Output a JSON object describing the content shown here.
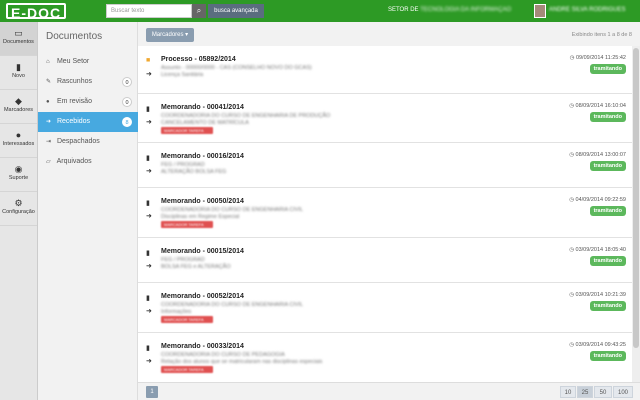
{
  "header": {
    "logo": "E-DOC",
    "search_placeholder": "Buscar texto",
    "advanced_search": "busca avançada",
    "setor_label": "SETOR DE",
    "setor_name": "TECNOLOGIA DA INFORMAÇÃO",
    "user_name": "ANDRÉ SILVA RODRIGUES"
  },
  "nav": {
    "items": [
      {
        "label": "Documentos",
        "icon": "inbox-icon"
      },
      {
        "label": "Novo",
        "icon": "file-icon"
      },
      {
        "label": "Marcadores",
        "icon": "tags-icon"
      },
      {
        "label": "Interessados",
        "icon": "user-icon"
      },
      {
        "label": "Suporte",
        "icon": "comments-icon"
      },
      {
        "label": "Configuração",
        "icon": "cogs-icon"
      }
    ]
  },
  "sidebar": {
    "title": "Documentos",
    "items": [
      {
        "label": "Meu Setor",
        "badge": ""
      },
      {
        "label": "Rascunhos",
        "badge": "0"
      },
      {
        "label": "Em revisão",
        "badge": "0"
      },
      {
        "label": "Recebidos",
        "badge": "8"
      },
      {
        "label": "Despachados",
        "badge": ""
      },
      {
        "label": "Arquivados",
        "badge": ""
      }
    ]
  },
  "toolbar": {
    "marcadores_label": "Marcadores ▾",
    "exibindo": "Exibindo itens 1 a 8 de 8"
  },
  "documents": [
    {
      "title": "Processo - 05892/2014",
      "line2": "Assunto - 00000/0000 - CAS (CONSELHO NOVO DO GCAS)",
      "line3": "Licença Sanitária",
      "tag": "",
      "date": "09/09/2014 11:25:42",
      "status": "tramitando"
    },
    {
      "title": "Memorando - 00041/2014",
      "line2": "COORDENADORIA DO CURSO DE ENGENHARIA DE PRODUÇÃO",
      "line3": "CANCELAMENTO DE MATRÍCULA",
      "tag": "MARCADOR TAREFA",
      "date": "08/09/2014 16:10:04",
      "status": "tramitando"
    },
    {
      "title": "Memorando - 00016/2014",
      "line2": "FEG / PROGRAD",
      "line3": "ALTERAÇÃO BOLSA FEG",
      "tag": "",
      "date": "08/09/2014 13:00:07",
      "status": "tramitando"
    },
    {
      "title": "Memorando - 00050/2014",
      "line2": "COORDENADORIA DO CURSO DE ENGENHARIA CIVIL",
      "line3": "Disciplinas em Regime Especial",
      "tag": "MARCADOR TAREFA",
      "date": "04/09/2014 09:22:59",
      "status": "tramitando"
    },
    {
      "title": "Memorando - 00015/2014",
      "line2": "FEG / PROGRAD",
      "line3": "BOLSA FEG e ALTERAÇÃO",
      "tag": "",
      "date": "03/09/2014 18:05:40",
      "status": "tramitando"
    },
    {
      "title": "Memorando - 00052/2014",
      "line2": "COORDENADORIA DO CURSO DE ENGENHARIA CIVIL",
      "line3": "Informações",
      "tag": "MARCADOR TAREFA",
      "date": "03/09/2014 10:21:39",
      "status": "tramitando"
    },
    {
      "title": "Memorando - 00033/2014",
      "line2": "COORDENADORIA DO CURSO DE PEDAGOGIA",
      "line3": "Relação dos alunos que se matricularam nas disciplinas especiais",
      "tag": "MARCADOR TAREFA",
      "date": "03/09/2014 09:43:25",
      "status": "tramitando"
    }
  ],
  "pagination": {
    "current": "1",
    "sizes": [
      "10",
      "25",
      "50",
      "100"
    ]
  },
  "colors": {
    "brand_green": "#2d9a25",
    "active_blue": "#47a9e0",
    "status_green": "#5cb85c",
    "tag_red": "#e05050"
  }
}
